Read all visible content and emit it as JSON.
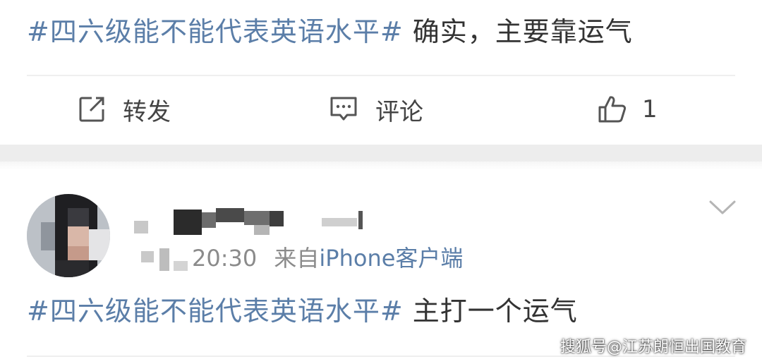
{
  "post1": {
    "hashtag": "#四六级能不能代表英语水平#",
    "text": "确实，主要靠运气"
  },
  "actions": {
    "repost_label": "转发",
    "comment_label": "评论",
    "like_count": "1"
  },
  "post2": {
    "time": "20:30",
    "source_prefix": "来自",
    "source": "iPhone客户端",
    "hashtag": "#四六级能不能代表英语水平#",
    "text": "主打一个运气"
  },
  "watermark": "搜狐号@江苏朗恒出国教育",
  "icons": {
    "repost": "share-edit-icon",
    "comment": "comment-icon",
    "like": "thumbs-up-icon",
    "more": "chevron-down-icon"
  },
  "colors": {
    "hashtag": "#5b7ea8",
    "text": "#333333",
    "meta": "#8b8b8b",
    "separator": "#ededed"
  }
}
